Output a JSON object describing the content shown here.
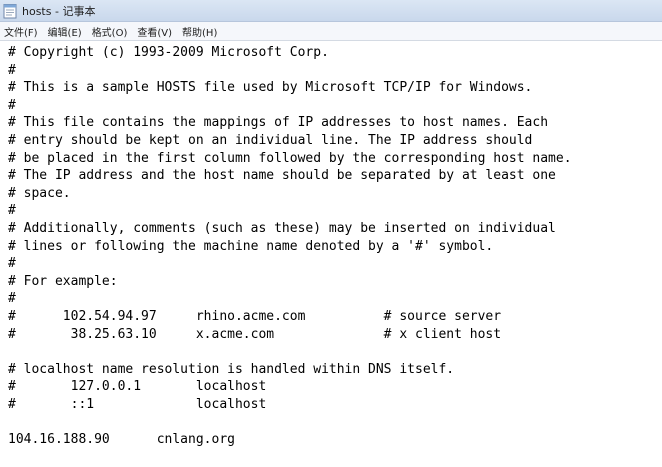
{
  "window": {
    "title": "hosts - 记事本",
    "icon": "notepad-icon"
  },
  "menu": [
    {
      "label": "文件(F)"
    },
    {
      "label": "编辑(E)"
    },
    {
      "label": "格式(O)"
    },
    {
      "label": "查看(V)"
    },
    {
      "label": "帮助(H)"
    }
  ],
  "editor": {
    "lines": [
      "# Copyright (c) 1993-2009 Microsoft Corp.",
      "#",
      "# This is a sample HOSTS file used by Microsoft TCP/IP for Windows.",
      "#",
      "# This file contains the mappings of IP addresses to host names. Each",
      "# entry should be kept on an individual line. The IP address should",
      "# be placed in the first column followed by the corresponding host name.",
      "# The IP address and the host name should be separated by at least one",
      "# space.",
      "#",
      "# Additionally, comments (such as these) may be inserted on individual",
      "# lines or following the machine name denoted by a '#' symbol.",
      "#",
      "# For example:",
      "#",
      "#      102.54.94.97     rhino.acme.com          # source server",
      "#       38.25.63.10     x.acme.com              # x client host",
      "",
      "# localhost name resolution is handled within DNS itself.",
      "#       127.0.0.1       localhost",
      "#       ::1             localhost",
      "",
      "104.16.188.90      cnlang.org"
    ]
  }
}
